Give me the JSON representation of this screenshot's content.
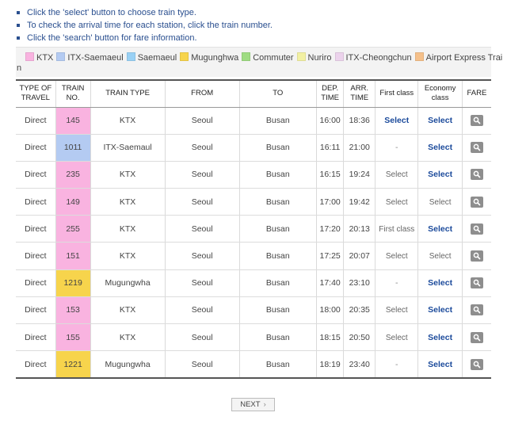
{
  "instructions": [
    "Click the 'select' button to choose train type.",
    "To check the arrival time for each station, click the train number.",
    "Click the 'search' button for fare information."
  ],
  "legend": [
    {
      "label": "KTX",
      "color": "#f9b3e0"
    },
    {
      "label": "ITX-Saemaeul",
      "color": "#b4cbf2"
    },
    {
      "label": "Saemaeul",
      "color": "#99d1f5"
    },
    {
      "label": "Mugunghwa",
      "color": "#f7d44c"
    },
    {
      "label": "Commuter",
      "color": "#9fdc83"
    },
    {
      "label": "Nuriro",
      "color": "#f2f0a3"
    },
    {
      "label": "ITX-Cheongchun",
      "color": "#ecd3ec"
    },
    {
      "label": "Airport Express Trai",
      "color": "#f5c08a"
    }
  ],
  "legend_wrap": "n",
  "headers": {
    "type_of_travel": "TYPE OF TRAVEL",
    "train_no": "TRAIN NO.",
    "train_type": "TRAIN TYPE",
    "from": "FROM",
    "to": "TO",
    "dep_time": "DEP. TIME",
    "arr_time": "ARR. TIME",
    "first_class": "First class",
    "economy_class": "Economy class",
    "fare": "FARE"
  },
  "rows": [
    {
      "travel": "Direct",
      "train_no": "145",
      "type": "KTX",
      "color": "#f9b3e0",
      "from": "Seoul",
      "to": "Busan",
      "dep": "16:00",
      "arr": "18:36",
      "first": "Select",
      "first_state": "on",
      "economy": "Select",
      "economy_state": "on"
    },
    {
      "travel": "Direct",
      "train_no": "1011",
      "type": "ITX-Saemaul",
      "color": "#b4cbf2",
      "from": "Seoul",
      "to": "Busan",
      "dep": "16:11",
      "arr": "21:00",
      "first": "-",
      "first_state": "none",
      "economy": "Select",
      "economy_state": "on"
    },
    {
      "travel": "Direct",
      "train_no": "235",
      "type": "KTX",
      "color": "#f9b3e0",
      "from": "Seoul",
      "to": "Busan",
      "dep": "16:15",
      "arr": "19:24",
      "first": "Select",
      "first_state": "off",
      "economy": "Select",
      "economy_state": "on"
    },
    {
      "travel": "Direct",
      "train_no": "149",
      "type": "KTX",
      "color": "#f9b3e0",
      "from": "Seoul",
      "to": "Busan",
      "dep": "17:00",
      "arr": "19:42",
      "first": "Select",
      "first_state": "off",
      "economy": "Select",
      "economy_state": "off"
    },
    {
      "travel": "Direct",
      "train_no": "255",
      "type": "KTX",
      "color": "#f9b3e0",
      "from": "Seoul",
      "to": "Busan",
      "dep": "17:20",
      "arr": "20:13",
      "first": "First class",
      "first_state": "off",
      "economy": "Select",
      "economy_state": "on"
    },
    {
      "travel": "Direct",
      "train_no": "151",
      "type": "KTX",
      "color": "#f9b3e0",
      "from": "Seoul",
      "to": "Busan",
      "dep": "17:25",
      "arr": "20:07",
      "first": "Select",
      "first_state": "off",
      "economy": "Select",
      "economy_state": "off"
    },
    {
      "travel": "Direct",
      "train_no": "1219",
      "type": "Mugungwha",
      "color": "#f7d44c",
      "from": "Seoul",
      "to": "Busan",
      "dep": "17:40",
      "arr": "23:10",
      "first": "-",
      "first_state": "none",
      "economy": "Select",
      "economy_state": "on"
    },
    {
      "travel": "Direct",
      "train_no": "153",
      "type": "KTX",
      "color": "#f9b3e0",
      "from": "Seoul",
      "to": "Busan",
      "dep": "18:00",
      "arr": "20:35",
      "first": "Select",
      "first_state": "off",
      "economy": "Select",
      "economy_state": "on"
    },
    {
      "travel": "Direct",
      "train_no": "155",
      "type": "KTX",
      "color": "#f9b3e0",
      "from": "Seoul",
      "to": "Busan",
      "dep": "18:15",
      "arr": "20:50",
      "first": "Select",
      "first_state": "off",
      "economy": "Select",
      "economy_state": "on"
    },
    {
      "travel": "Direct",
      "train_no": "1221",
      "type": "Mugungwha",
      "color": "#f7d44c",
      "from": "Seoul",
      "to": "Busan",
      "dep": "18:19",
      "arr": "23:40",
      "first": "-",
      "first_state": "none",
      "economy": "Select",
      "economy_state": "on"
    }
  ],
  "fare_icon": "search-icon",
  "pagination": {
    "next_label": "NEXT",
    "next_icon": "chevron-right-icon"
  }
}
